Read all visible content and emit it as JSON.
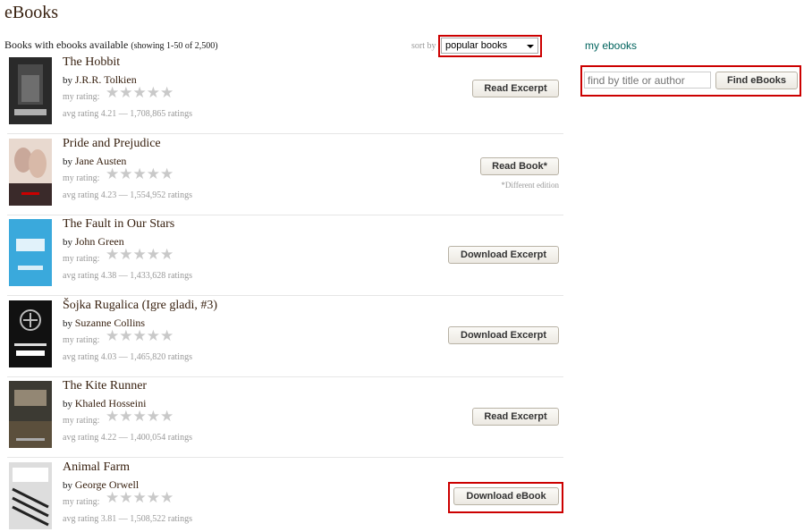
{
  "page": {
    "title": "eBooks",
    "subtitle": "Books with ebooks available",
    "subtitle_count": "(showing 1-50 of 2,500)",
    "sort_label": "sort by",
    "sort_value": "popular books"
  },
  "sidebar": {
    "my_ebooks": "my ebooks",
    "search_placeholder": "find by title or author",
    "find_button": "Find eBooks"
  },
  "books": [
    {
      "title": "The Hobbit",
      "by": "by",
      "author": "J.R.R. Tolkien",
      "my_rating_label": "my rating:",
      "stars": "★★★★★",
      "avg": "avg rating 4.21 — 1,708,865 ratings",
      "button": "Read Excerpt",
      "note": ""
    },
    {
      "title": "Pride and Prejudice",
      "by": "by",
      "author": "Jane Austen",
      "my_rating_label": "my rating:",
      "stars": "★★★★★",
      "avg": "avg rating 4.23 — 1,554,952 ratings",
      "button": "Read Book*",
      "note": "*Different edition"
    },
    {
      "title": "The Fault in Our Stars",
      "by": "by",
      "author": "John Green",
      "my_rating_label": "my rating:",
      "stars": "★★★★★",
      "avg": "avg rating 4.38 — 1,433,628 ratings",
      "button": "Download Excerpt",
      "note": ""
    },
    {
      "title": "Šojka Rugalica (Igre gladi, #3)",
      "by": "by",
      "author": "Suzanne Collins",
      "my_rating_label": "my rating:",
      "stars": "★★★★★",
      "avg": "avg rating 4.03 — 1,465,820 ratings",
      "button": "Download Excerpt",
      "note": ""
    },
    {
      "title": "The Kite Runner",
      "by": "by",
      "author": "Khaled Hosseini",
      "my_rating_label": "my rating:",
      "stars": "★★★★★",
      "avg": "avg rating 4.22 — 1,400,054 ratings",
      "button": "Read Excerpt",
      "note": ""
    },
    {
      "title": "Animal Farm",
      "by": "by",
      "author": "George Orwell",
      "my_rating_label": "my rating:",
      "stars": "★★★★★",
      "avg": "avg rating 3.81 — 1,508,522 ratings",
      "button": "Download eBook",
      "note": ""
    }
  ],
  "colors": {
    "link_brown": "#382110",
    "highlight_red": "#cc0000",
    "sidebar_link": "#00635d"
  }
}
